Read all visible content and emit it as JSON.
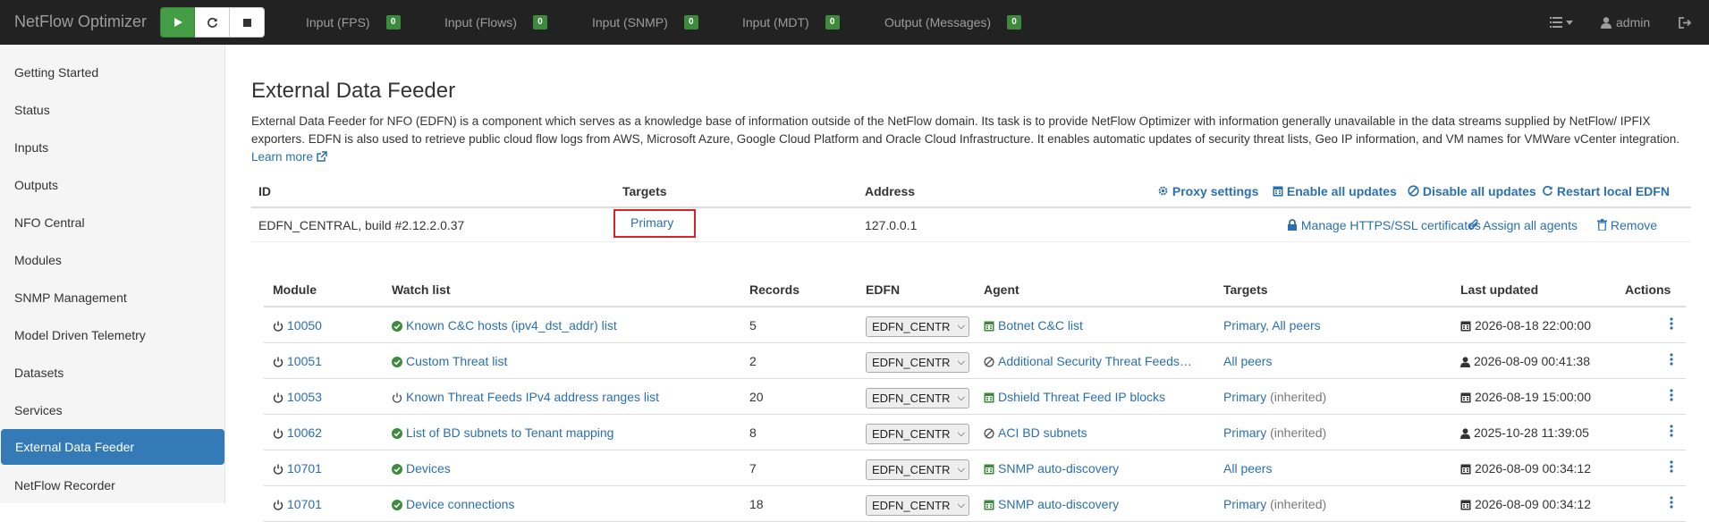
{
  "app": {
    "title": "NetFlow Optimizer",
    "user": "admin"
  },
  "nav_stats": [
    {
      "label": "Input (FPS)",
      "count": "0"
    },
    {
      "label": "Input (Flows)",
      "count": "0"
    },
    {
      "label": "Input (SNMP)",
      "count": "0"
    },
    {
      "label": "Input (MDT)",
      "count": "0"
    },
    {
      "label": "Output (Messages)",
      "count": "0"
    }
  ],
  "sidebar": {
    "items": [
      {
        "label": "Getting Started"
      },
      {
        "label": "Status"
      },
      {
        "label": "Inputs"
      },
      {
        "label": "Outputs"
      },
      {
        "label": "NFO Central"
      },
      {
        "label": "Modules"
      },
      {
        "label": "SNMP Management"
      },
      {
        "label": "Model Driven Telemetry"
      },
      {
        "label": "Datasets"
      },
      {
        "label": "Services"
      },
      {
        "label": "External Data Feeder"
      },
      {
        "label": "NetFlow Recorder"
      }
    ],
    "active": "External Data Feeder"
  },
  "page": {
    "title": "External Data Feeder",
    "description": "External Data Feeder for NFO (EDFN) is a component which serves as a knowledge base of information outside of the NetFlow domain. Its task is to provide NetFlow Optimizer with information generally unavailable in the data streams supplied by NetFlow/ IPFIX exporters. EDFN is also used to retrieve public cloud flow logs from AWS, Microsoft Azure, Google Cloud Platform and Oracle Cloud Infrastructure. It enables automatic updates of security threat lists, Geo IP information, and VM names for VMWare vCenter integration.",
    "learn_more": "Learn more"
  },
  "edfn": {
    "headers": {
      "id": "ID",
      "targets": "Targets",
      "address": "Address"
    },
    "actions": {
      "proxy": "Proxy settings",
      "enable_all": "Enable all updates",
      "disable_all": "Disable all updates",
      "restart": "Restart local EDFN"
    },
    "row": {
      "id": "EDFN_CENTRAL, build #2.12.2.0.37",
      "target": "Primary",
      "address": "127.0.0.1",
      "manage_ssl": "Manage HTTPS/SSL certificates",
      "assign_agents": "Assign all agents",
      "remove": "Remove"
    }
  },
  "modules": {
    "headers": {
      "module": "Module",
      "watch_list": "Watch list",
      "records": "Records",
      "edfn": "EDFN",
      "agent": "Agent",
      "targets": "Targets",
      "last_updated": "Last updated",
      "actions": "Actions"
    },
    "rows": [
      {
        "module": "10050",
        "watch": "Known C&C hosts (ipv4_dst_addr) list",
        "watch_ok": true,
        "records": "5",
        "edfn": "EDFN_CENTR",
        "agent": "Botnet C&C list",
        "agent_icon": "calendar",
        "targets": "Primary, All peers",
        "targets_note": "",
        "updated": "2026-08-18 22:00:00",
        "updated_icon": "calendar"
      },
      {
        "module": "10051",
        "watch": "Custom Threat list",
        "watch_ok": true,
        "records": "2",
        "edfn": "EDFN_CENTR",
        "agent": "Additional Security Threat Feeds…",
        "agent_icon": "disabled",
        "targets": "All peers",
        "targets_note": "",
        "updated": "2026-08-09 00:41:38",
        "updated_icon": "user"
      },
      {
        "module": "10053",
        "watch": "Known Threat Feeds IPv4 address ranges list",
        "watch_ok": false,
        "records": "20",
        "edfn": "EDFN_CENTR",
        "agent": "Dshield Threat Feed IP blocks",
        "agent_icon": "calendar",
        "targets": "Primary",
        "targets_note": "(inherited)",
        "updated": "2026-08-19 15:00:00",
        "updated_icon": "calendar"
      },
      {
        "module": "10062",
        "watch": "List of BD subnets to Tenant mapping",
        "watch_ok": true,
        "records": "8",
        "edfn": "EDFN_CENTR",
        "agent": "ACI BD subnets",
        "agent_icon": "disabled",
        "targets": "Primary",
        "targets_note": "(inherited)",
        "updated": "2025-10-28 11:39:05",
        "updated_icon": "user"
      },
      {
        "module": "10701",
        "watch": "Devices",
        "watch_ok": true,
        "records": "7",
        "edfn": "EDFN_CENTR",
        "agent": "SNMP auto-discovery",
        "agent_icon": "calendar",
        "targets": "All peers",
        "targets_note": "",
        "updated": "2026-08-09 00:34:12",
        "updated_icon": "calendar"
      },
      {
        "module": "10701",
        "watch": "Device connections",
        "watch_ok": true,
        "records": "18",
        "edfn": "EDFN_CENTR",
        "agent": "SNMP auto-discovery",
        "agent_icon": "calendar",
        "targets": "Primary",
        "targets_note": "(inherited)",
        "updated": "2026-08-09 00:34:12",
        "updated_icon": "calendar"
      }
    ]
  },
  "colors": {
    "navbar": "#222222",
    "accent": "#337ab7",
    "link": "#2a6fb0",
    "play": "#449d44",
    "badge": "#3c8a3c",
    "ok": "#3c8a3c",
    "highlight": "#d9232a"
  }
}
